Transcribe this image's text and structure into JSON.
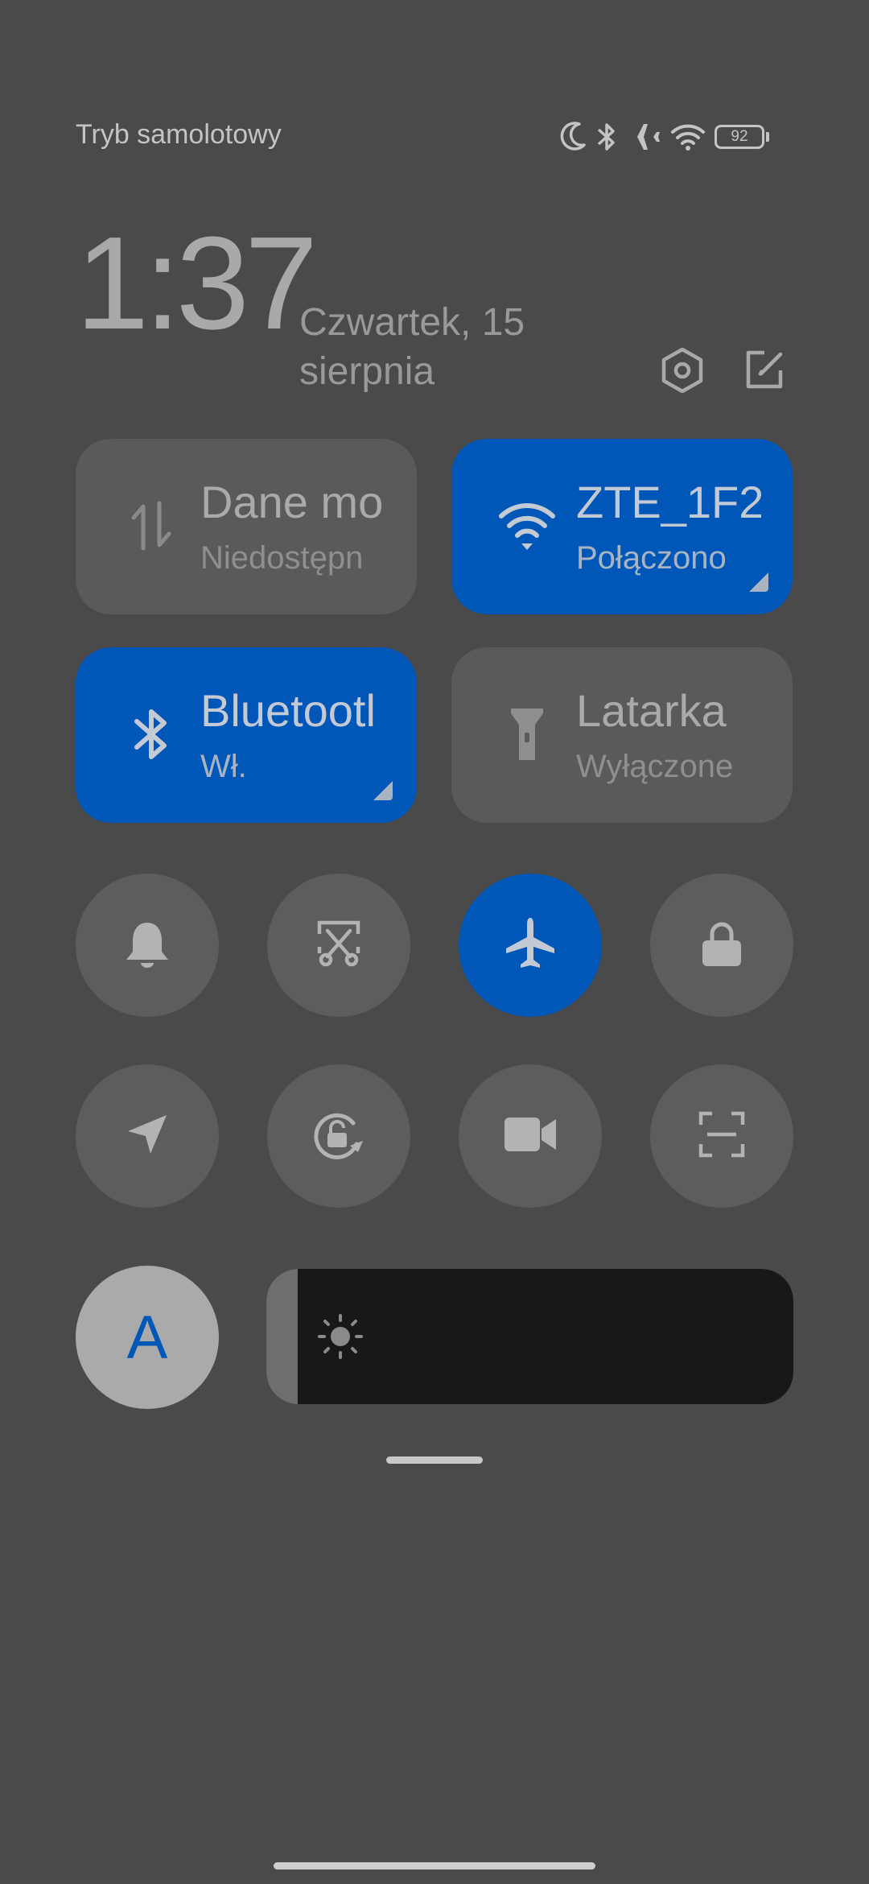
{
  "status_bar": {
    "mode_text": "Tryb samolotowy",
    "icons": [
      "moon-icon",
      "bluetooth-icon",
      "airplane-icon",
      "wifi-icon"
    ],
    "battery_level": "92"
  },
  "header": {
    "time": "1:37",
    "date_line1": "Czwartek, 15",
    "date_line2": "sierpnia",
    "icons": [
      "settings-icon",
      "edit-icon"
    ]
  },
  "tiles": [
    {
      "title": "Dane mo",
      "subtitle": "Niedostępn",
      "icon": "mobile-data-icon",
      "active": false
    },
    {
      "title": "ZTE_1F2",
      "subtitle": "Połączono",
      "icon": "wifi-icon",
      "active": true
    },
    {
      "title": "Bluetootl",
      "subtitle": "Wł.",
      "icon": "bluetooth-icon",
      "active": true
    },
    {
      "title": "Latarka",
      "subtitle": "Wyłączone",
      "icon": "flashlight-icon",
      "active": false
    }
  ],
  "toggles": [
    {
      "icon": "bell-icon",
      "active": false
    },
    {
      "icon": "screenshot-icon",
      "active": false
    },
    {
      "icon": "airplane-icon",
      "active": true
    },
    {
      "icon": "lock-icon",
      "active": false
    },
    {
      "icon": "location-icon",
      "active": false
    },
    {
      "icon": "rotation-lock-icon",
      "active": false
    },
    {
      "icon": "video-camera-icon",
      "active": false
    },
    {
      "icon": "scan-icon",
      "active": false
    }
  ],
  "brightness": {
    "auto_label": "A",
    "level_fraction": 0.06,
    "icon": "sun-icon"
  },
  "colors": {
    "background": "#4a4a4a",
    "accent": "#0057b8",
    "tile": "#5a5a5a"
  }
}
